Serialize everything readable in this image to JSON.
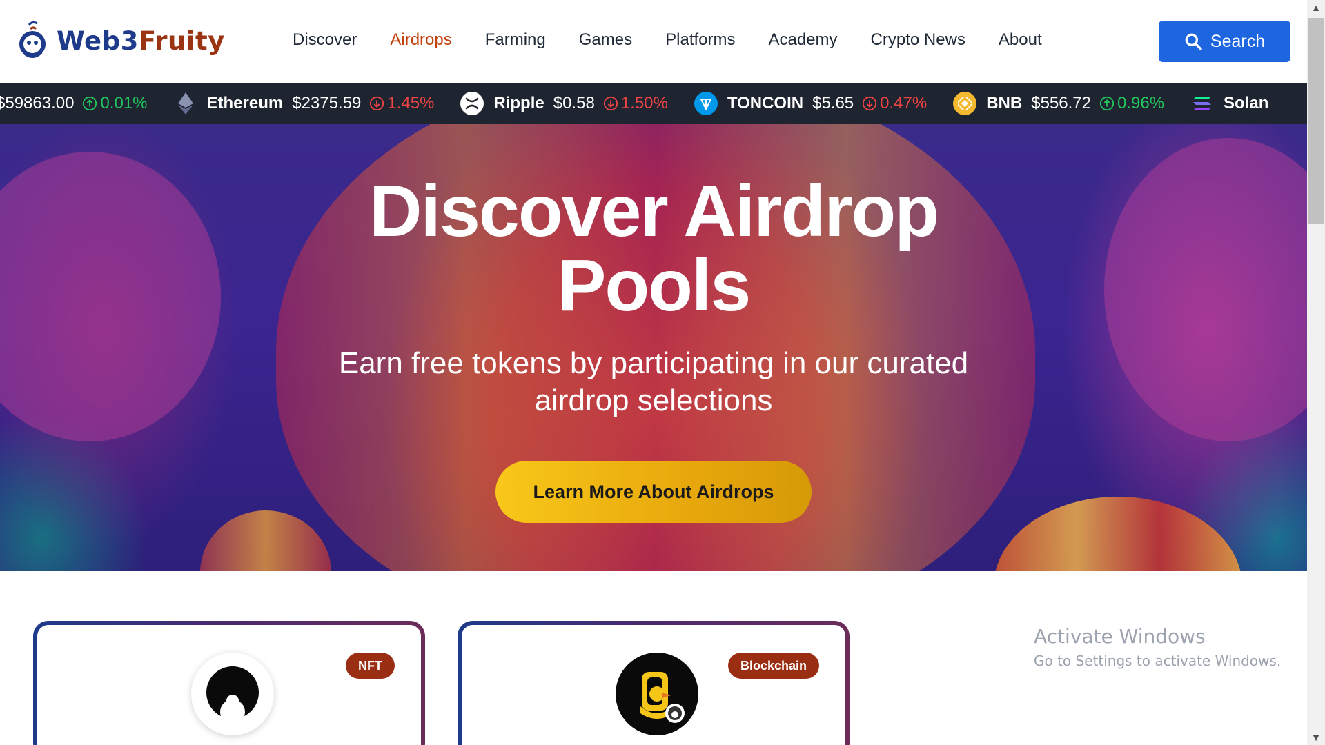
{
  "header": {
    "logo": {
      "part1": "Web3",
      "part2": "Fruity",
      "icon": "fruity-logo-icon"
    },
    "nav": [
      {
        "label": "Discover",
        "active": false
      },
      {
        "label": "Airdrops",
        "active": true
      },
      {
        "label": "Farming",
        "active": false
      },
      {
        "label": "Games",
        "active": false
      },
      {
        "label": "Platforms",
        "active": false
      },
      {
        "label": "Academy",
        "active": false
      },
      {
        "label": "Crypto News",
        "active": false
      },
      {
        "label": "About",
        "active": false
      }
    ],
    "search_label": "Search",
    "accent_color": "#1d66e0",
    "active_nav_color": "#c2410c"
  },
  "ticker": [
    {
      "name": "",
      "price": "$59863.00",
      "change": "0.01%",
      "direction": "up",
      "icon": "bitcoin-icon"
    },
    {
      "name": "Ethereum",
      "price": "$2375.59",
      "change": "1.45%",
      "direction": "down",
      "icon": "ethereum-icon"
    },
    {
      "name": "Ripple",
      "price": "$0.58",
      "change": "1.50%",
      "direction": "down",
      "icon": "ripple-icon"
    },
    {
      "name": "TONCOIN",
      "price": "$5.65",
      "change": "0.47%",
      "direction": "down",
      "icon": "toncoin-icon"
    },
    {
      "name": "BNB",
      "price": "$556.72",
      "change": "0.96%",
      "direction": "up",
      "icon": "bnb-icon"
    },
    {
      "name": "Solan",
      "price": "",
      "change": "",
      "direction": "",
      "icon": "solana-icon"
    }
  ],
  "hero": {
    "title_line1": "Discover Airdrop",
    "title_line2": "Pools",
    "subtitle_line1": "Earn free tokens by participating in our curated",
    "subtitle_line2": "airdrop selections",
    "cta_label": "Learn More About Airdrops"
  },
  "cards": [
    {
      "badge": "NFT",
      "avatar_icon": "ghost-avatar-icon"
    },
    {
      "badge": "Blockchain",
      "avatar_icon": "duck-avatar-icon"
    }
  ],
  "watermark": {
    "title": "Activate Windows",
    "subtitle": "Go to Settings to activate Windows."
  }
}
